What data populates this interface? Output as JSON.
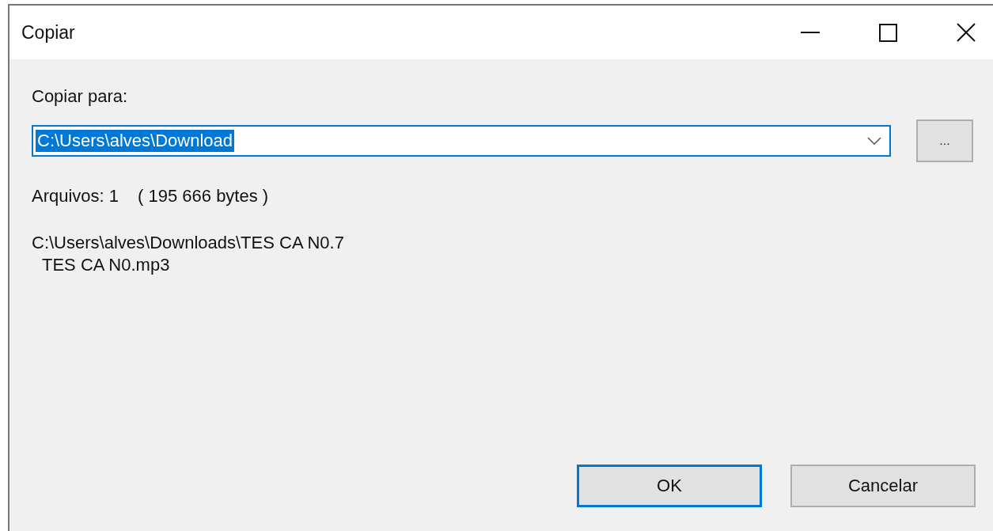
{
  "window": {
    "title": "Copiar"
  },
  "destination": {
    "label": "Copiar para:",
    "value": "C:\\Users\\alves\\Download",
    "value_selected": true
  },
  "browse_button": {
    "label": "..."
  },
  "summary": {
    "count": "Arquivos: 1",
    "size": "( 195 666 bytes )"
  },
  "file_list": [
    {
      "kind": "path",
      "text": "C:\\Users\\alves\\Downloads\\TES CA N0.7"
    },
    {
      "kind": "file",
      "text": "TES CA N0.mp3"
    }
  ],
  "buttons": [
    {
      "label": "OK",
      "default": true
    },
    {
      "label": "Cancelar",
      "default": false
    }
  ]
}
